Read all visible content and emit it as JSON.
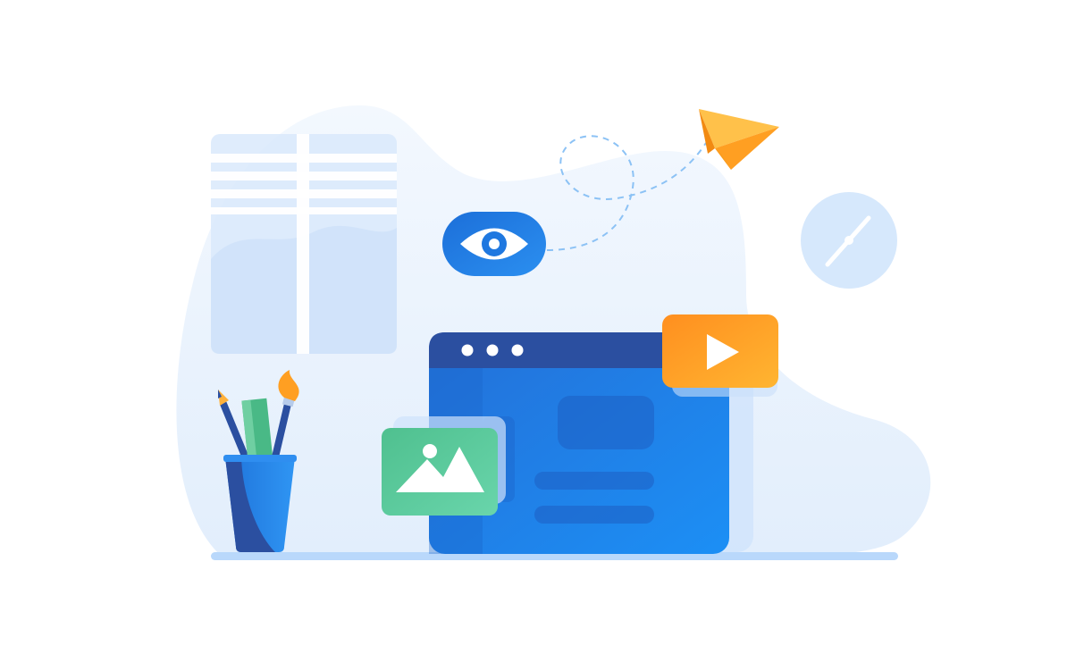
{
  "illustration": {
    "kind": "flat web-design illustration",
    "icons": [
      "window-icon",
      "eye-icon",
      "paper-plane-icon",
      "clock-icon",
      "browser-window-icon",
      "play-icon",
      "image-icon",
      "pencil-cup-icon"
    ],
    "colors": {
      "background": "#ffffff",
      "blob": "#e9f2fd",
      "window_pane": "#d9e9fb",
      "browser_body": "#1e7fe6",
      "browser_bar": "#2b4fa0",
      "eye_badge": "#1f78e0",
      "play_card": "#ffa12b",
      "image_card": "#5ccb9b",
      "plane": "#ffae2a",
      "cup": "#1f7de0",
      "floor": "#b9d8fb"
    }
  }
}
